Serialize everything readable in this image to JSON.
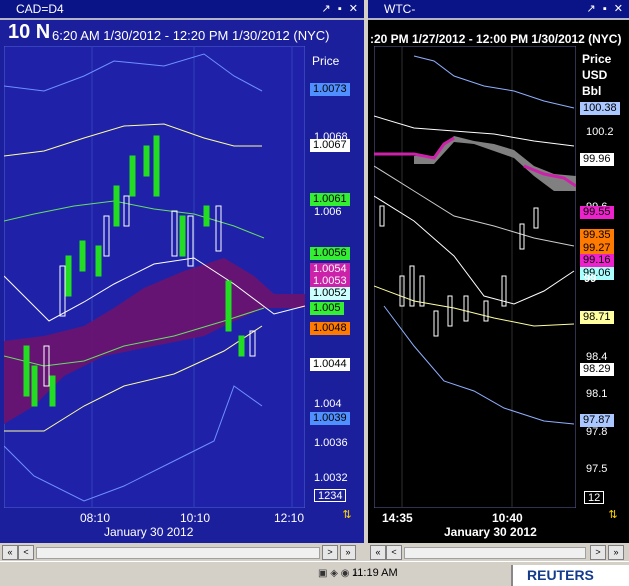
{
  "left": {
    "title": "CAD=D4",
    "big_label": "10 N",
    "range": "6:20 AM 1/30/2012 - 12:20 PM 1/30/2012 (NYC)",
    "axis_caption": "Price",
    "scale": [
      "1.0068",
      "1.006",
      "1.0052",
      "1.0044",
      "1.004",
      "1.0036",
      "1.0032"
    ],
    "tags": [
      {
        "v": "1.0073",
        "bg": "#4f8fff",
        "fg": "#000"
      },
      {
        "v": "1.0067",
        "bg": "#ffffff",
        "fg": "#000"
      },
      {
        "v": "1.0061",
        "bg": "#33ee33",
        "fg": "#000"
      },
      {
        "v": "1.0056",
        "bg": "#33ee33",
        "fg": "#000"
      },
      {
        "v": "1.0054",
        "bg": "#cc22aa",
        "fg": "#fff"
      },
      {
        "v": "1.0053",
        "bg": "#cc22aa",
        "fg": "#fff"
      },
      {
        "v": "1.0052",
        "bg": "#ccffff",
        "fg": "#000"
      },
      {
        "v": "1.005",
        "bg": "#33ee33",
        "fg": "#000"
      },
      {
        "v": "1.0048",
        "bg": "#ff7a00",
        "fg": "#000"
      },
      {
        "v": "1.0044",
        "bg": "#ffffff",
        "fg": "#000"
      },
      {
        "v": "1.0039",
        "bg": "#4f8fff",
        "fg": "#000"
      }
    ],
    "volume_box": "1234",
    "xticks": [
      "08:10",
      "10:10",
      "12:10"
    ],
    "date": "January 30 2012"
  },
  "right": {
    "title": "WTC-",
    "range": ":20 PM 1/27/2012 - 12:00 PM 1/30/2012 (NYC)",
    "axis_caption": [
      "Price",
      "USD",
      "Bbl"
    ],
    "scale": [
      "100.2",
      "99.6",
      "98.4",
      "98.1",
      "97.8",
      "97.5"
    ],
    "tags": [
      {
        "v": "100.38",
        "bg": "#aac8ff",
        "fg": "#000"
      },
      {
        "v": "99.96",
        "bg": "#ffffff",
        "fg": "#000"
      },
      {
        "v": "99.55",
        "bg": "#ee22cc",
        "fg": "#000"
      },
      {
        "v": "99.35",
        "bg": "#ff7a00",
        "fg": "#000"
      },
      {
        "v": "99.27",
        "bg": "#ff7a00",
        "fg": "#000"
      },
      {
        "v": "99.16",
        "bg": "#ee22cc",
        "fg": "#000"
      },
      {
        "v": "99.06",
        "bg": "#aaffff",
        "fg": "#000"
      },
      {
        "v": "98.71",
        "bg": "#ffffa0",
        "fg": "#000"
      },
      {
        "v": "98.29",
        "bg": "#ffffff",
        "fg": "#000"
      },
      {
        "v": "97.87",
        "bg": "#aac8ff",
        "fg": "#000"
      }
    ],
    "extra_scale": "99",
    "volume_box": "12",
    "xticks": [
      "14:35",
      "10:40"
    ],
    "date": "January 30 2012"
  },
  "taskbar": {
    "clock": "11:19 AM",
    "brand": "REUTERS"
  },
  "icons": {
    "nav_first": "«",
    "nav_prev": "<",
    "nav_next": ">",
    "nav_last": "»",
    "titlebar": "↗ ▪ ✕"
  }
}
